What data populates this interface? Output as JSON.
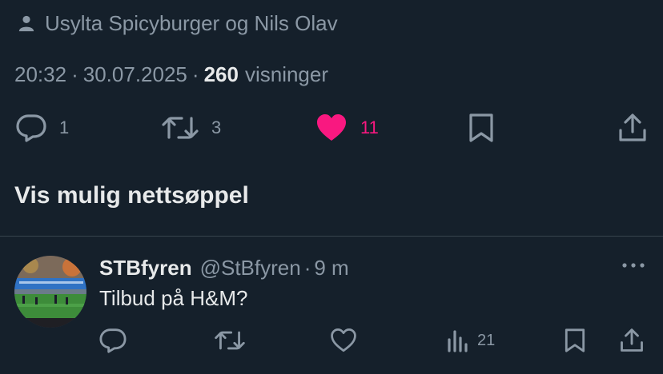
{
  "tagged_users": {
    "text": "Usylta Spicyburger og Nils Olav"
  },
  "meta": {
    "time": "20:32",
    "separator": "·",
    "date": "30.07.2025",
    "views_count": "260",
    "views_label": "visninger"
  },
  "actions": {
    "reply_count": "1",
    "retweet_count": "3",
    "like_count": "11"
  },
  "spam_link": "Vis mulig nettsøppel",
  "reply": {
    "name": "STBfyren",
    "handle": "@StBfyren",
    "dot": "·",
    "time": "9 m",
    "text": "Tilbud på H&M?",
    "views_count": "21"
  },
  "colors": {
    "background": "#15202b",
    "text": "#e7e9ea",
    "muted": "#8b98a5",
    "like_pink": "#f91880",
    "divider": "#38444d"
  },
  "icons": {
    "tagged": "person-icon",
    "reply": "speech-bubble-icon",
    "retweet": "retweet-icon",
    "like": "heart-icon",
    "bookmark": "bookmark-icon",
    "share": "share-icon",
    "views": "bar-chart-icon",
    "more": "more-dots-icon"
  }
}
